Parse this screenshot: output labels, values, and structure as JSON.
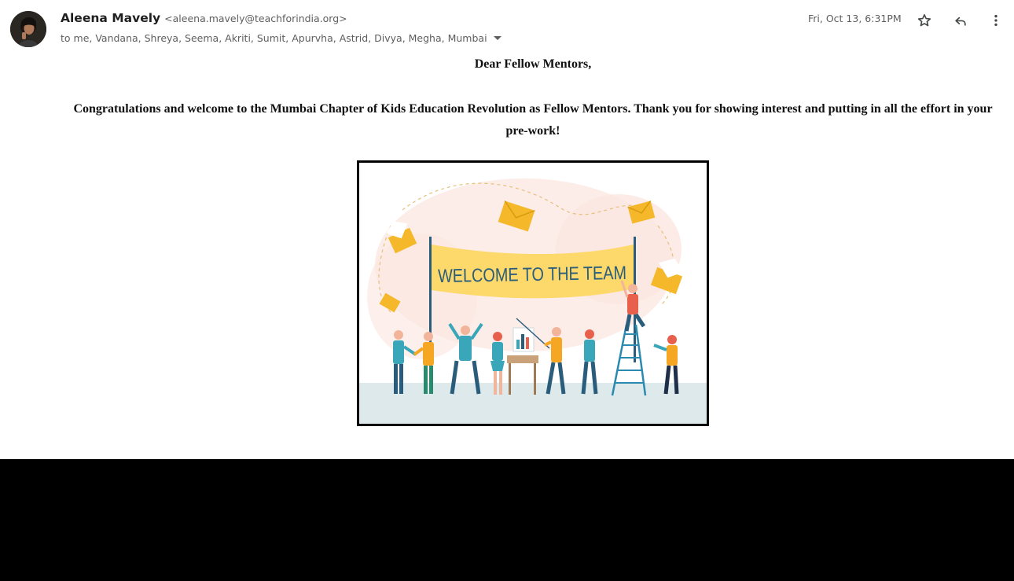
{
  "header": {
    "sender_name": "Aleena Mavely",
    "sender_email": "<aleena.mavely@teachforindia.org>",
    "recipients": "to me, Vandana, Shreya, Seema, Akriti, Sumit, Apurvha, Astrid, Divya, Megha, Mumbai",
    "date": "Fri, Oct 13, 6:31PM"
  },
  "icons": {
    "star": "star-icon",
    "reply": "reply-icon",
    "more": "more-vertical-icon",
    "caret": "chevron-down-icon"
  },
  "body": {
    "greeting": "Dear Fellow Mentors,",
    "paragraph": "Congratulations and welcome to the Mumbai Chapter of Kids Education Revolution as Fellow Mentors. Thank you for showing interest and putting in all the effort in your pre-work!"
  },
  "image": {
    "banner_text": "WELCOME TO THE TEAM"
  },
  "colors": {
    "banner": "#fdd86a",
    "banner_text": "#2a5d7c",
    "envelope": "#f5b82a",
    "ground": "#dde9ea",
    "blob": "#fbe6e0"
  }
}
